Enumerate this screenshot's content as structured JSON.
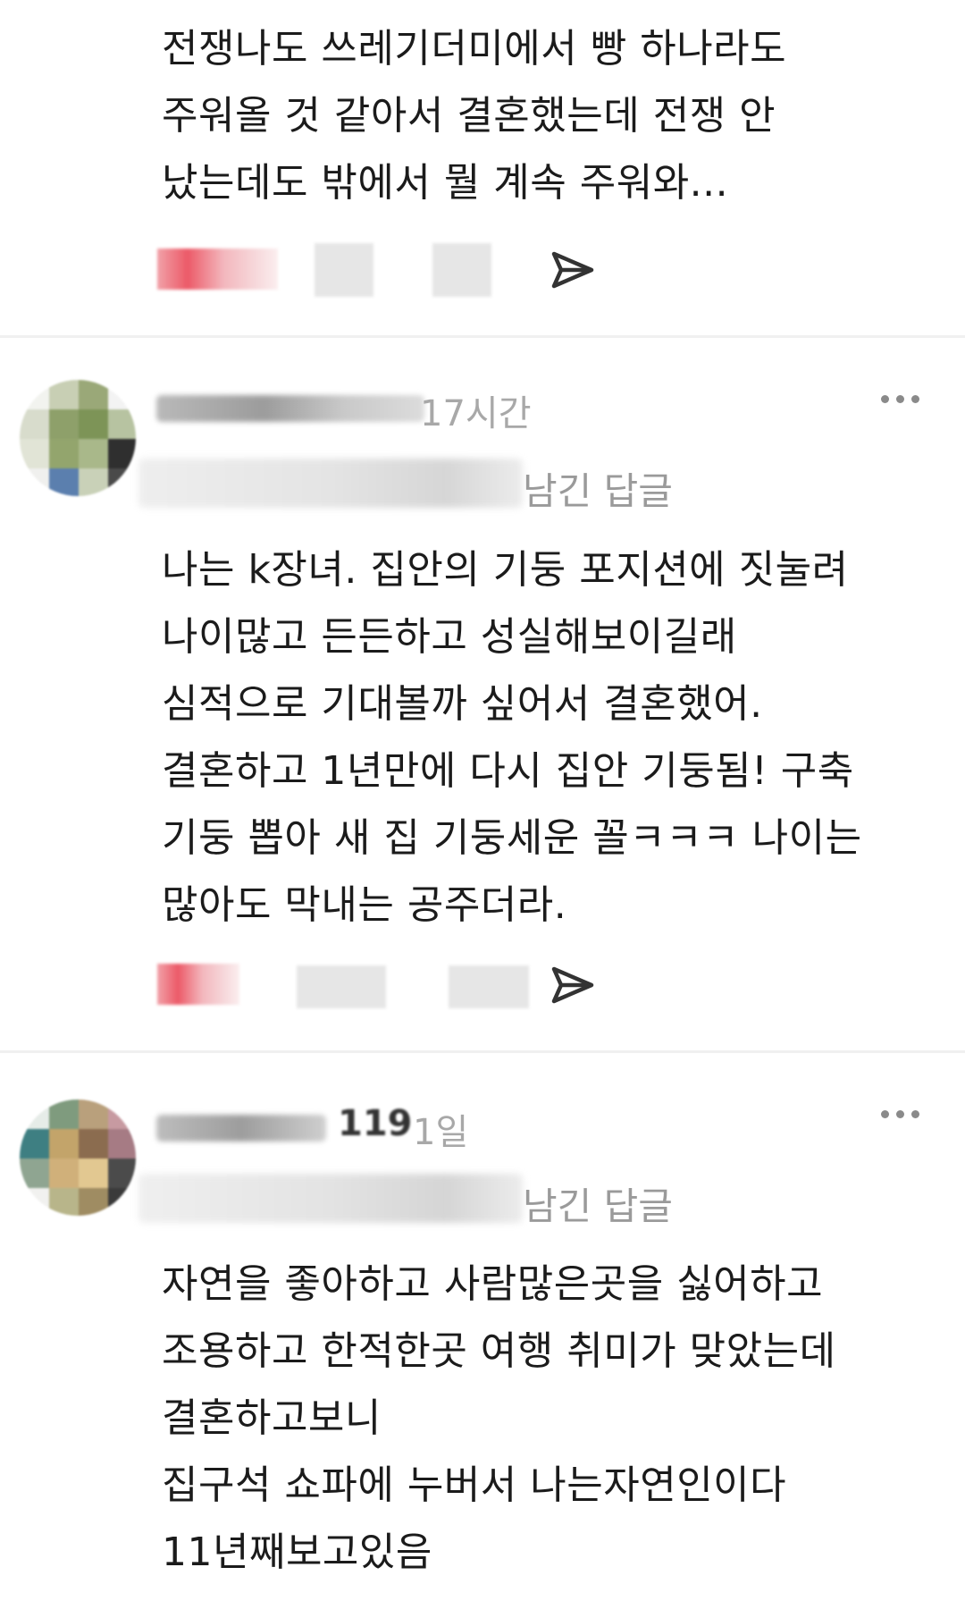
{
  "comments": [
    {
      "lines": [
        "전쟁나도 쓰레기더미에서 빵 하나라도",
        "주워올 것 같아서 결혼했는데 전쟁 안",
        "났는데도 밖에서 뭘 계속 주워와..."
      ]
    },
    {
      "timestamp": "17시간",
      "reply_label": "남긴 답글",
      "lines": [
        "나는 k장녀. 집안의 기둥 포지션에 짓눌려",
        "나이많고 든든하고 성실해보이길래",
        "심적으로 기대볼까 싶어서 결혼했어.",
        "결혼하고 1년만에 다시 집안 기둥됨! 구축",
        "기둥 뽑아 새 집 기둥세운 꼴ㅋㅋㅋ 나이는",
        "많아도 막내는 공주더라."
      ]
    },
    {
      "timestamp": "1일",
      "username_partial": "119",
      "reply_label": "남긴 답글",
      "lines": [
        "자연을 좋아하고 사람많은곳을 싫어하고",
        "조용하고 한적한곳 여행 취미가 맞았는데",
        "결혼하고보니",
        "집구석 쇼파에 누버서 나는자연인이다",
        "11년째보고있음"
      ]
    }
  ],
  "icons": {
    "share": "send-icon",
    "more": "more-icon",
    "like": "heart-icon"
  },
  "colors": {
    "like_accent": "#ec5a68",
    "muted_text": "#a8a8a8"
  }
}
